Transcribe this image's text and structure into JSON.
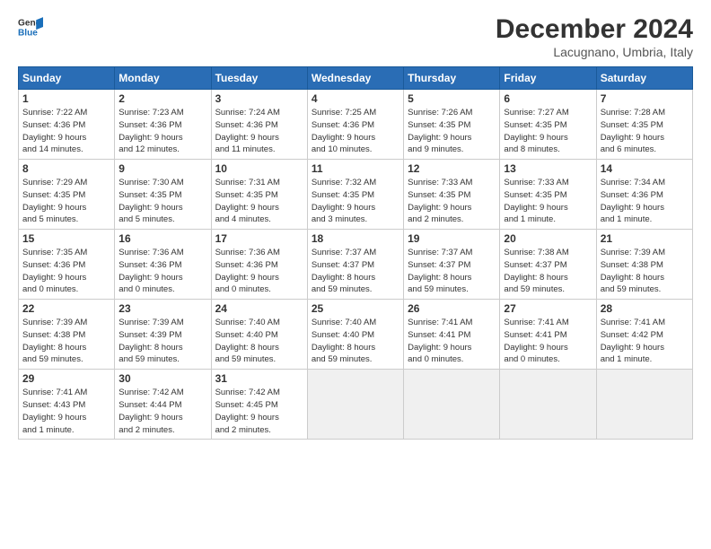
{
  "logo": {
    "line1": "General",
    "line2": "Blue"
  },
  "title": "December 2024",
  "location": "Lacugnano, Umbria, Italy",
  "headers": [
    "Sunday",
    "Monday",
    "Tuesday",
    "Wednesday",
    "Thursday",
    "Friday",
    "Saturday"
  ],
  "weeks": [
    [
      {
        "day": "1",
        "info": "Sunrise: 7:22 AM\nSunset: 4:36 PM\nDaylight: 9 hours\nand 14 minutes."
      },
      {
        "day": "2",
        "info": "Sunrise: 7:23 AM\nSunset: 4:36 PM\nDaylight: 9 hours\nand 12 minutes."
      },
      {
        "day": "3",
        "info": "Sunrise: 7:24 AM\nSunset: 4:36 PM\nDaylight: 9 hours\nand 11 minutes."
      },
      {
        "day": "4",
        "info": "Sunrise: 7:25 AM\nSunset: 4:36 PM\nDaylight: 9 hours\nand 10 minutes."
      },
      {
        "day": "5",
        "info": "Sunrise: 7:26 AM\nSunset: 4:35 PM\nDaylight: 9 hours\nand 9 minutes."
      },
      {
        "day": "6",
        "info": "Sunrise: 7:27 AM\nSunset: 4:35 PM\nDaylight: 9 hours\nand 8 minutes."
      },
      {
        "day": "7",
        "info": "Sunrise: 7:28 AM\nSunset: 4:35 PM\nDaylight: 9 hours\nand 6 minutes."
      }
    ],
    [
      {
        "day": "8",
        "info": "Sunrise: 7:29 AM\nSunset: 4:35 PM\nDaylight: 9 hours\nand 5 minutes."
      },
      {
        "day": "9",
        "info": "Sunrise: 7:30 AM\nSunset: 4:35 PM\nDaylight: 9 hours\nand 5 minutes."
      },
      {
        "day": "10",
        "info": "Sunrise: 7:31 AM\nSunset: 4:35 PM\nDaylight: 9 hours\nand 4 minutes."
      },
      {
        "day": "11",
        "info": "Sunrise: 7:32 AM\nSunset: 4:35 PM\nDaylight: 9 hours\nand 3 minutes."
      },
      {
        "day": "12",
        "info": "Sunrise: 7:33 AM\nSunset: 4:35 PM\nDaylight: 9 hours\nand 2 minutes."
      },
      {
        "day": "13",
        "info": "Sunrise: 7:33 AM\nSunset: 4:35 PM\nDaylight: 9 hours\nand 1 minute."
      },
      {
        "day": "14",
        "info": "Sunrise: 7:34 AM\nSunset: 4:36 PM\nDaylight: 9 hours\nand 1 minute."
      }
    ],
    [
      {
        "day": "15",
        "info": "Sunrise: 7:35 AM\nSunset: 4:36 PM\nDaylight: 9 hours\nand 0 minutes."
      },
      {
        "day": "16",
        "info": "Sunrise: 7:36 AM\nSunset: 4:36 PM\nDaylight: 9 hours\nand 0 minutes."
      },
      {
        "day": "17",
        "info": "Sunrise: 7:36 AM\nSunset: 4:36 PM\nDaylight: 9 hours\nand 0 minutes."
      },
      {
        "day": "18",
        "info": "Sunrise: 7:37 AM\nSunset: 4:37 PM\nDaylight: 8 hours\nand 59 minutes."
      },
      {
        "day": "19",
        "info": "Sunrise: 7:37 AM\nSunset: 4:37 PM\nDaylight: 8 hours\nand 59 minutes."
      },
      {
        "day": "20",
        "info": "Sunrise: 7:38 AM\nSunset: 4:37 PM\nDaylight: 8 hours\nand 59 minutes."
      },
      {
        "day": "21",
        "info": "Sunrise: 7:39 AM\nSunset: 4:38 PM\nDaylight: 8 hours\nand 59 minutes."
      }
    ],
    [
      {
        "day": "22",
        "info": "Sunrise: 7:39 AM\nSunset: 4:38 PM\nDaylight: 8 hours\nand 59 minutes."
      },
      {
        "day": "23",
        "info": "Sunrise: 7:39 AM\nSunset: 4:39 PM\nDaylight: 8 hours\nand 59 minutes."
      },
      {
        "day": "24",
        "info": "Sunrise: 7:40 AM\nSunset: 4:40 PM\nDaylight: 8 hours\nand 59 minutes."
      },
      {
        "day": "25",
        "info": "Sunrise: 7:40 AM\nSunset: 4:40 PM\nDaylight: 8 hours\nand 59 minutes."
      },
      {
        "day": "26",
        "info": "Sunrise: 7:41 AM\nSunset: 4:41 PM\nDaylight: 9 hours\nand 0 minutes."
      },
      {
        "day": "27",
        "info": "Sunrise: 7:41 AM\nSunset: 4:41 PM\nDaylight: 9 hours\nand 0 minutes."
      },
      {
        "day": "28",
        "info": "Sunrise: 7:41 AM\nSunset: 4:42 PM\nDaylight: 9 hours\nand 1 minute."
      }
    ],
    [
      {
        "day": "29",
        "info": "Sunrise: 7:41 AM\nSunset: 4:43 PM\nDaylight: 9 hours\nand 1 minute."
      },
      {
        "day": "30",
        "info": "Sunrise: 7:42 AM\nSunset: 4:44 PM\nDaylight: 9 hours\nand 2 minutes."
      },
      {
        "day": "31",
        "info": "Sunrise: 7:42 AM\nSunset: 4:45 PM\nDaylight: 9 hours\nand 2 minutes."
      },
      null,
      null,
      null,
      null
    ]
  ]
}
